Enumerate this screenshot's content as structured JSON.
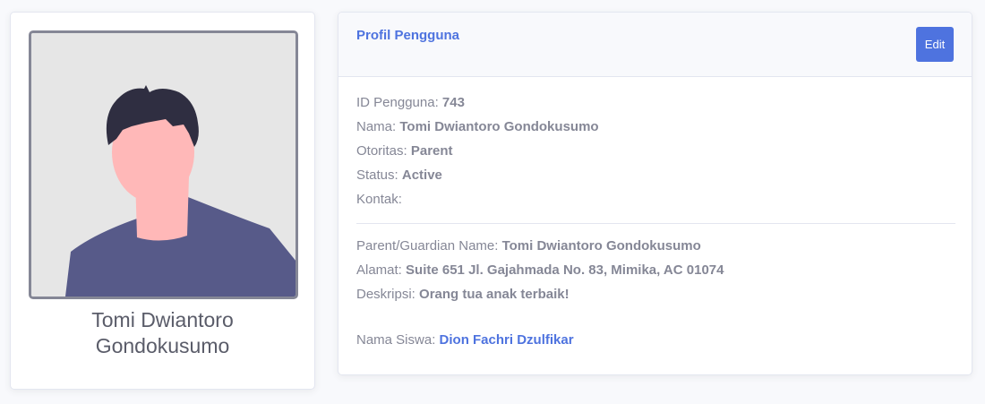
{
  "avatar": {
    "name_line1": "Tomi Dwiantoro",
    "name_line2": "Gondokusumo",
    "icon": "user-avatar-illustration",
    "colors": {
      "background": "#e6e6e6",
      "hair": "#2f2e41",
      "skin": "#ffb8b8",
      "shirt": "#575a89"
    }
  },
  "profile": {
    "title": "Profil Pengguna",
    "edit_label": "Edit",
    "fields": {
      "user_id": {
        "label": "ID Pengguna:",
        "value": "743"
      },
      "name": {
        "label": "Nama:",
        "value": "Tomi Dwiantoro Gondokusumo"
      },
      "authority": {
        "label": "Otoritas:",
        "value": "Parent"
      },
      "status": {
        "label": "Status:",
        "value": "Active"
      },
      "contact": {
        "label": "Kontak:",
        "value": ""
      },
      "guardian_name": {
        "label": "Parent/Guardian Name:",
        "value": "Tomi Dwiantoro Gondokusumo"
      },
      "address": {
        "label": "Alamat:",
        "value": "Suite 651 Jl. Gajahmada No. 83, Mimika, AC 01074"
      },
      "description": {
        "label": "Deskripsi:",
        "value": "Orang tua anak terbaik!"
      },
      "student_name": {
        "label": "Nama Siswa:",
        "value": "Dion Fachri Dzulfikar"
      }
    }
  },
  "colors": {
    "accent": "#4e73df",
    "text": "#858796",
    "page_background": "#f8f9fc"
  }
}
